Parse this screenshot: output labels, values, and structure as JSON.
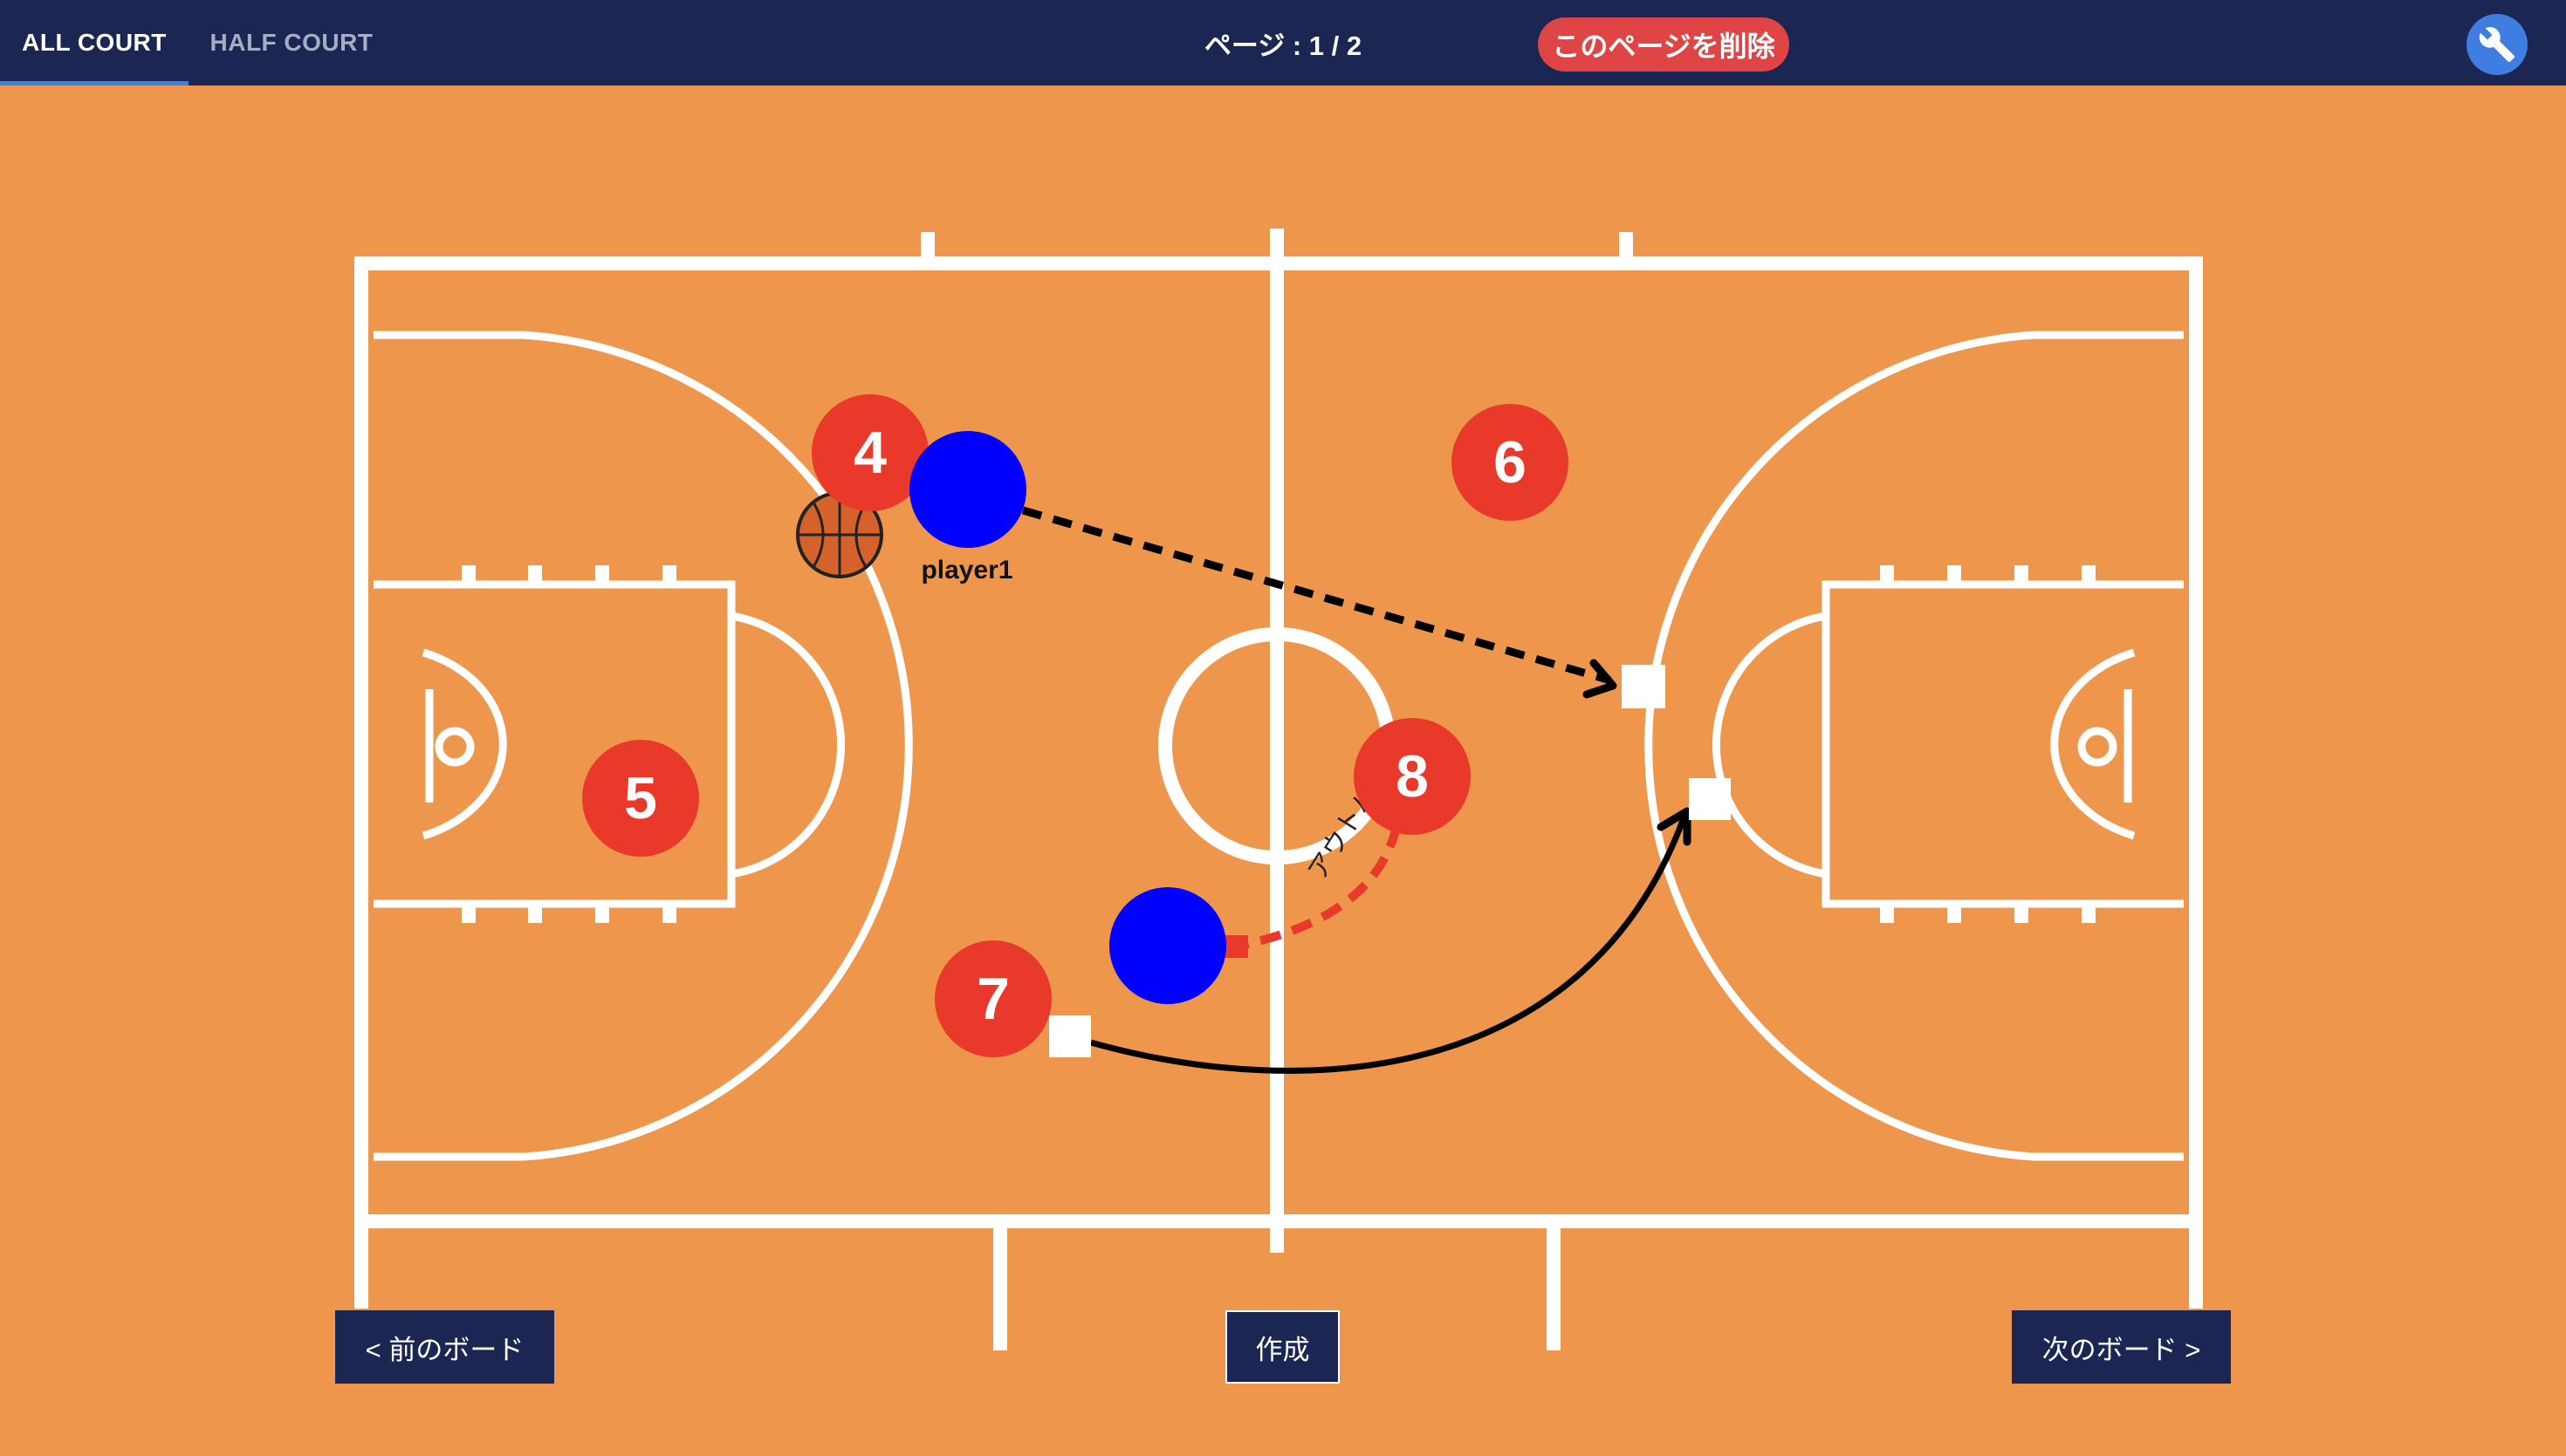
{
  "tabs": [
    {
      "label": "ALL COURT",
      "active": true
    },
    {
      "label": "HALF COURT",
      "active": false
    }
  ],
  "page_indicator": "ページ : 1 / 2",
  "delete_page_label": "このページを削除",
  "settings_icon": "wrench-icon",
  "players": {
    "red": [
      "4",
      "5",
      "6",
      "7",
      "8"
    ],
    "blue_label": "player1"
  },
  "annotation_text": "アウトハー",
  "buttons": {
    "prev": "< 前のボード",
    "create": "作成",
    "next": "次のボード >"
  },
  "colors": {
    "topbar": "#1b2652",
    "court": "#ee974c",
    "accent": "#3f7de0",
    "delete": "#e04545",
    "red_player": "#e8392a",
    "blue_player": "#0000ff"
  }
}
